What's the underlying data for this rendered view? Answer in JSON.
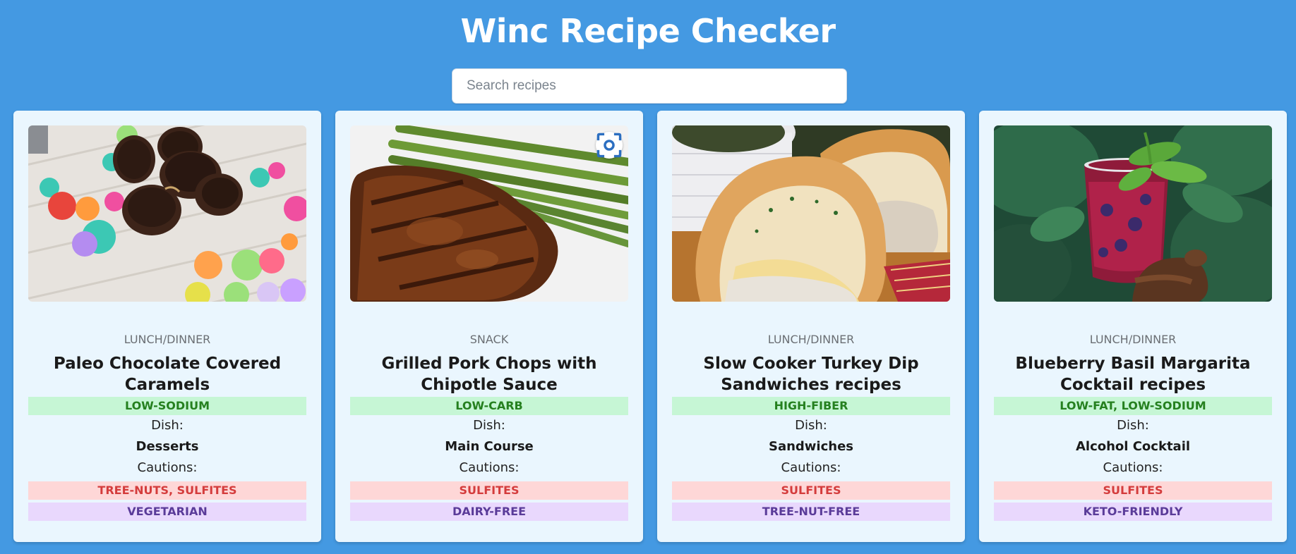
{
  "header": {
    "title": "Winc Recipe Checker"
  },
  "search": {
    "placeholder": "Search recipes",
    "value": ""
  },
  "labels": {
    "dish": "Dish:",
    "cautions": "Cautions:"
  },
  "recipes": [
    {
      "meal_type": "LUNCH/DINNER",
      "title": "Paleo Chocolate Covered Caramels",
      "health_labels": "LOW-SODIUM",
      "dish_type": "Desserts",
      "cautions": "TREE-NUTS, SULFITES",
      "diet_label": "VEGETARIAN",
      "image": "chocolate-caramels-photo"
    },
    {
      "meal_type": "SNACK",
      "title": "Grilled Pork Chops with Chipotle Sauce",
      "health_labels": "LOW-CARB",
      "dish_type": "Main Course",
      "cautions": "SULFITES",
      "diet_label": "DAIRY-FREE",
      "image": "pork-chops-photo"
    },
    {
      "meal_type": "LUNCH/DINNER",
      "title": "Slow Cooker Turkey Dip Sandwiches recipes",
      "health_labels": "HIGH-FIBER",
      "dish_type": "Sandwiches",
      "cautions": "SULFITES",
      "diet_label": "TREE-NUT-FREE",
      "image": "turkey-sandwich-photo"
    },
    {
      "meal_type": "LUNCH/DINNER",
      "title": "Blueberry Basil Margarita Cocktail recipes",
      "health_labels": "LOW-FAT, LOW-SODIUM",
      "dish_type": "Alcohol Cocktail",
      "cautions": "SULFITES",
      "diet_label": "KETO-FRIENDLY",
      "image": "margarita-photo"
    }
  ],
  "colors": {
    "background": "#4499e2",
    "card": "#eaf6fe",
    "health_tag_bg": "#c6f6d5",
    "health_tag_text": "#25801f",
    "caution_tag_bg": "#fed7d7",
    "caution_tag_text": "#d43c3c",
    "diet_tag_bg": "#e9d8fd",
    "diet_tag_text": "#5a3b99"
  },
  "icons": {
    "image_lens": "lens-scan-icon"
  }
}
